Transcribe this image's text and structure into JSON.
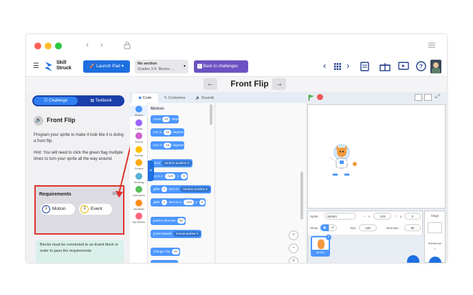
{
  "app": {
    "logo_line1": "Skill",
    "logo_line2": "Struck",
    "launchpad_label": "Launch Pad",
    "section_title": "No section",
    "section_sub": "Grades 3-5: Blocks ...",
    "back_label": "Back to challenges",
    "challenge_title": "Front Flip"
  },
  "left": {
    "tab_challenge": "Challenge",
    "tab_textbook": "Textbook",
    "title": "Front Flip",
    "description": "Program your sprite to make it look like it is doing a front flip.",
    "hint": "Hint: You will need to click the green flag multiple times to turn your sprite all the way around.",
    "req_title": "Requirements",
    "req_count": "0/2",
    "req1_num": "1",
    "req1_label": "Motion",
    "req2_num": "1",
    "req2_label": "Event",
    "note": "Blocks must be connected to an Event block in order to pass the requirements"
  },
  "editor": {
    "tab_code": "Code",
    "tab_costumes": "Costumes",
    "tab_sounds": "Sounds",
    "palette_title": "Motion",
    "categories": [
      {
        "label": "Motion",
        "color": "#4c97ff"
      },
      {
        "label": "Looks",
        "color": "#9966ff"
      },
      {
        "label": "Sound",
        "color": "#cf63cf"
      },
      {
        "label": "Events",
        "color": "#ffbf00"
      },
      {
        "label": "Control",
        "color": "#ffab19"
      },
      {
        "label": "Sensing",
        "color": "#5cb1d6"
      },
      {
        "label": "Operators",
        "color": "#59c059"
      },
      {
        "label": "Variables",
        "color": "#ff8c1a"
      },
      {
        "label": "My Blocks",
        "color": "#ff6680"
      }
    ],
    "blocks": {
      "move": "move",
      "move_val": "10",
      "move_unit": "steps",
      "turn_r": "turn",
      "turn_r_val": "15",
      "turn_r_unit": "degrees",
      "turn_l": "turn",
      "turn_l_val": "15",
      "turn_l_unit": "degrees",
      "goto": "go to",
      "goto_dd": "random position",
      "gotoxy": "go to x:",
      "gotoxy_x": "-123",
      "gotoxy_y_label": "y:",
      "gotoxy_y": "0",
      "glide1": "glide",
      "glide1_val": "1",
      "glide1_mid": "secs to",
      "glide1_dd": "random position",
      "glide2": "glide",
      "glide2_val": "1",
      "glide2_mid": "secs to x:",
      "glide2_x": "-123",
      "glide2_y_label": "y:",
      "glide2_y": "0",
      "point_dir": "point in direction",
      "point_dir_val": "90",
      "point_towards": "point towards",
      "point_towards_dd": "mouse-pointer",
      "change_x": "change x by",
      "change_x_val": "10"
    }
  },
  "stage": {
    "sprite_label": "Sprite",
    "sprite_name": "Sprite1",
    "x_label": "x",
    "x_val": "-123",
    "y_label": "y",
    "y_val": "0",
    "show_label": "Show",
    "size_label": "Size",
    "size_val": "100",
    "direction_label": "Direction",
    "direction_val": "90",
    "sprite_tile_name": "Sprite1",
    "stage_title": "Stage",
    "backdrops_label": "Backdrops",
    "backdrops_count": "1"
  },
  "colors": {
    "accent": "#1e6fe0",
    "highlight": "#e0312a",
    "motion": "#4c97ff",
    "back_button": "#6b52c2"
  }
}
